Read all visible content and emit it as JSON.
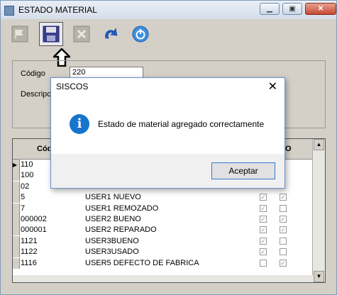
{
  "window": {
    "title": "ESTADO MATERIAL",
    "minimize_label": "▁",
    "restore_label": "▣",
    "close_label": "✕"
  },
  "toolbar": {
    "buttons": [
      {
        "icon": "flag-icon"
      },
      {
        "icon": "save-icon"
      },
      {
        "icon": "delete-icon"
      },
      {
        "icon": "undo-icon"
      },
      {
        "icon": "power-icon"
      }
    ]
  },
  "form": {
    "codigo_label": "Código",
    "codigo_value": "220",
    "descripcion_label": "Descripc"
  },
  "grid": {
    "header_codigo": "Cód",
    "header_last": "O",
    "rows": [
      {
        "codigo": "110",
        "descripcion": "",
        "c1": "",
        "c2": ""
      },
      {
        "codigo": "100",
        "descripcion": "",
        "c1": "",
        "c2": ""
      },
      {
        "codigo": "02",
        "descripcion": "",
        "c1": "",
        "c2": ""
      },
      {
        "codigo": "5",
        "descripcion": "USER1 NUEVO",
        "c1": "✓",
        "c2": "✓"
      },
      {
        "codigo": "7",
        "descripcion": "USER1 REMOZADO",
        "c1": "✓",
        "c2": ""
      },
      {
        "codigo": "000002",
        "descripcion": "USER2 BUENO",
        "c1": "✓",
        "c2": "✓"
      },
      {
        "codigo": "000001",
        "descripcion": "USER2 REPARADO",
        "c1": "✓",
        "c2": "✓"
      },
      {
        "codigo": "1121",
        "descripcion": "USER3BUENO",
        "c1": "✓",
        "c2": ""
      },
      {
        "codigo": "1122",
        "descripcion": "USER3USADO",
        "c1": "✓",
        "c2": ""
      },
      {
        "codigo": "1116",
        "descripcion": "USER5 DEFECTO DE FABRICA",
        "c1": "",
        "c2": "✓"
      }
    ]
  },
  "dialog": {
    "title": "SISCOS",
    "close_label": "✕",
    "info_icon_text": "i",
    "message": "Estado de material agregado correctamente",
    "ok_label": "Aceptar"
  }
}
